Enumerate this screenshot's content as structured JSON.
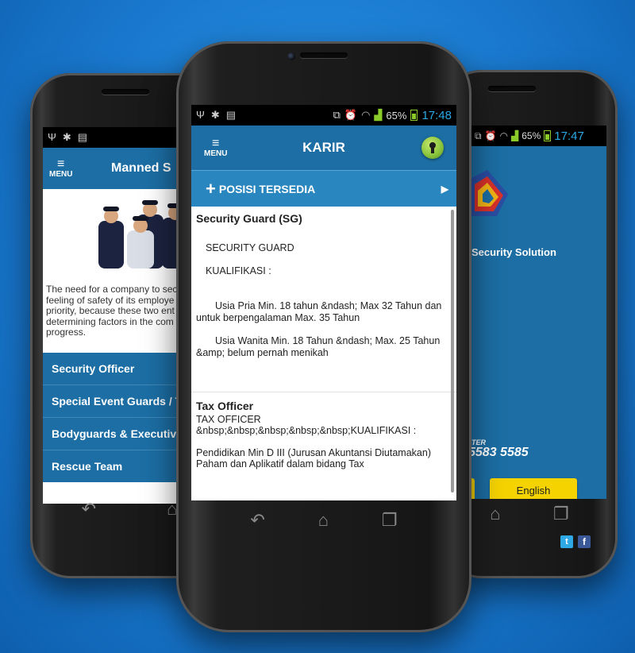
{
  "left_phone": {
    "header_title": "Manned S",
    "menu_label": "MENU",
    "description": "The need for a company to sec feeling of safety of its employe priority, because these two ent determining factors in the com and progress.",
    "list_items": [
      "Security Officer",
      "Special Event Guards / Ta",
      "Bodyguards & Executive P",
      "Rescue Team"
    ]
  },
  "center_phone": {
    "status": {
      "battery": "65%",
      "time": "17:48"
    },
    "menu_label": "MENU",
    "header_title": "KARIR",
    "section_header": "POSISI TERSEDIA",
    "jobs": [
      {
        "title": "Security Guard (SG)",
        "position": "SECURITY GUARD",
        "qual_label": "KUALIFIKASI :",
        "line1": "Usia Pria Min. 18 tahun &ndash; Max 32 Tahun dan untuk berpengalaman Max. 35 Tahun",
        "line2": "Usia Wanita Min. 18 Tahun &ndash; Max. 25 Tahun &amp; belum pernah menikah"
      },
      {
        "title": "Tax Officer",
        "position": "TAX OFFICER",
        "qual_label": "&nbsp;&nbsp;&nbsp;&nbsp;&nbsp;KUALIFIKASI :",
        "line1": "Pendidikan Min D III (Jurusan Akuntansi Diutamakan)",
        "line2": "Paham dan Aplikatif dalam bidang Tax"
      }
    ]
  },
  "right_phone": {
    "status": {
      "battery": "65%",
      "time": "17:47"
    },
    "brand_text": "Security Solution",
    "phone_label": "TER",
    "phone_number": "5583 5585",
    "english_button": "English"
  },
  "icons": [
    "usb-icon",
    "android-icon",
    "sd-card-icon",
    "screen-rotate-icon",
    "alarm-icon",
    "wifi-icon",
    "signal-icon",
    "battery-icon",
    "menu-icon",
    "key-icon",
    "plus-icon",
    "chevron-right-icon",
    "back-icon",
    "home-icon",
    "recent-apps-icon",
    "twitter-icon",
    "facebook-icon"
  ],
  "colors": {
    "app_blue": "#1c6ea4",
    "time_blue": "#29a9e6",
    "key_green": "#8bc53f",
    "english_yellow": "#f5d300"
  }
}
